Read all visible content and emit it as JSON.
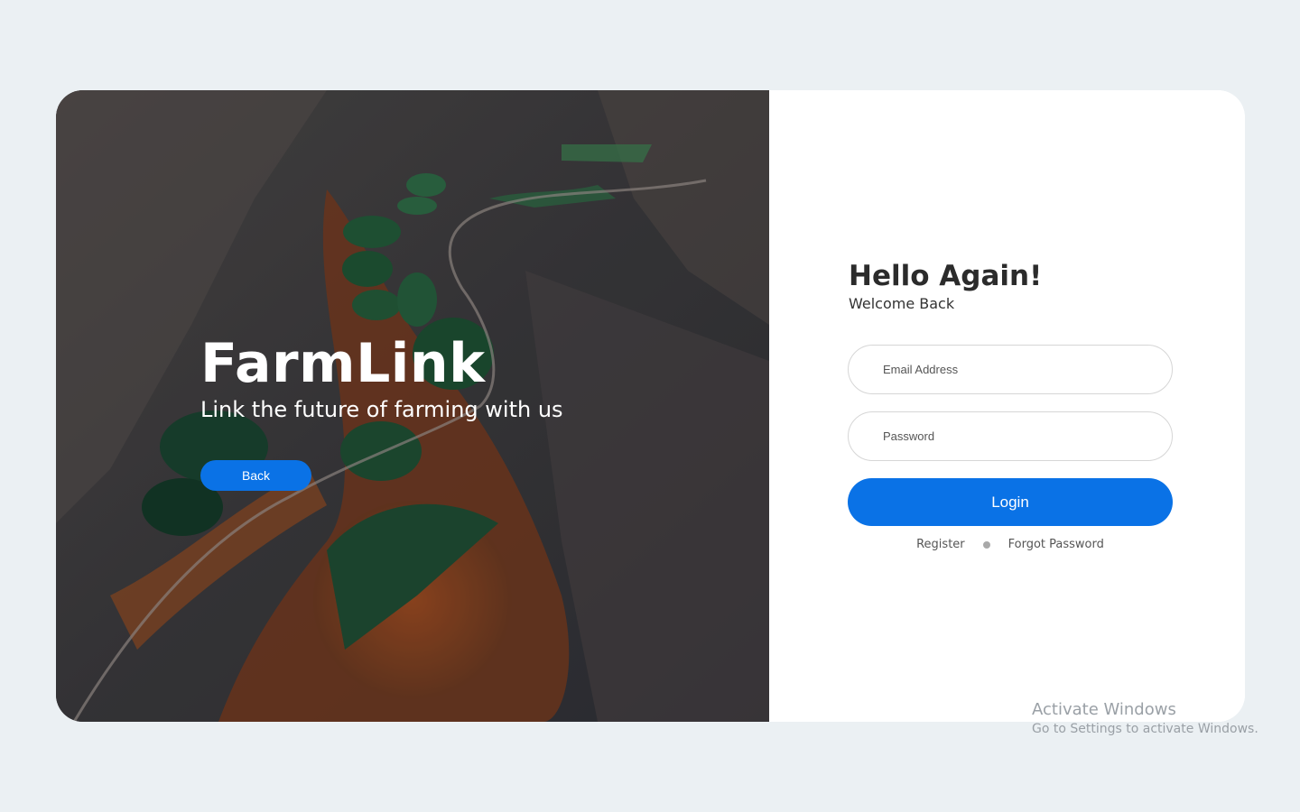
{
  "hero": {
    "title": "FarmLink",
    "subtitle": "Link the future of farming with us",
    "back_label": "Back"
  },
  "login": {
    "greeting": "Hello Again!",
    "welcome": "Welcome Back",
    "email_placeholder": "Email Address",
    "password_placeholder": "Password",
    "login_label": "Login",
    "register_label": "Register",
    "forgot_label": "Forgot Password"
  },
  "watermark": {
    "title": "Activate Windows",
    "subtitle": "Go to Settings to activate Windows."
  },
  "colors": {
    "page_background": "#ebf0f3",
    "accent": "#0a72e6",
    "card": "#ffffff"
  }
}
